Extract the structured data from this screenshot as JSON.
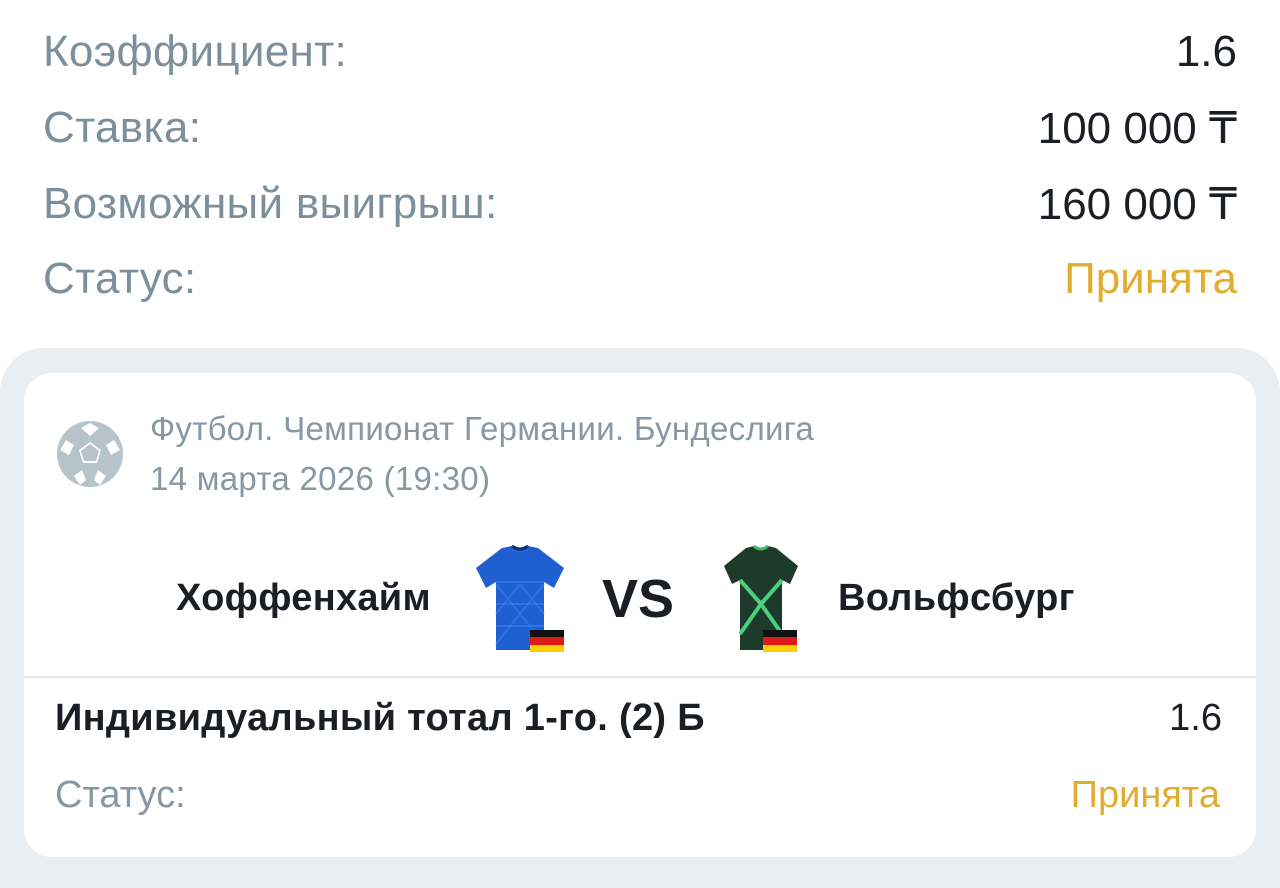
{
  "summary": {
    "coefficient_label": "Коэффициент:",
    "coefficient_value": "1.6",
    "stake_label": "Ставка:",
    "stake_value": "100 000 ₸",
    "payout_label": "Возможный выигрыш:",
    "payout_value": "160 000 ₸",
    "status_label": "Статус:",
    "status_value": "Принята"
  },
  "event": {
    "league": "Футбол. Чемпионат Германии. Бундеслига",
    "date": "14 марта 2026 (19:30)",
    "home_team": "Хоффенхайм",
    "away_team": "Вольфсбург",
    "vs": "VS",
    "sport_icon": "soccer-ball-icon",
    "home_jersey_icon": "jersey-blue-icon",
    "away_jersey_icon": "jersey-green-icon",
    "country_flag_icon": "germany-flag-icon"
  },
  "bet": {
    "market": "Индивидуальный тотал 1-го. (2) Б",
    "odds": "1.6",
    "status_label": "Статус:",
    "status_value": "Принята"
  },
  "colors": {
    "accent_status": "#e2ac2f",
    "label_gray": "#7c8f9b",
    "panel_bg": "#e9eef2",
    "home_jersey": "#1f5fd1",
    "away_jersey": "#1d3a2c"
  }
}
